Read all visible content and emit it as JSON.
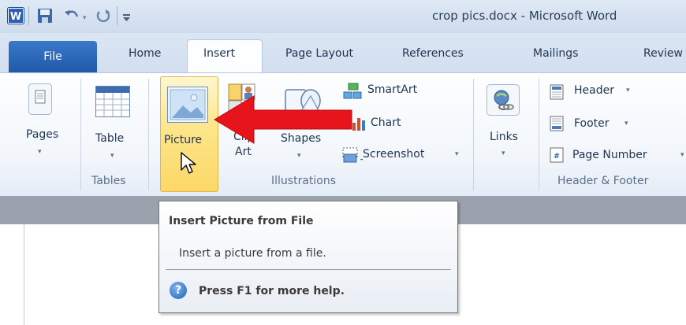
{
  "window": {
    "title": "crop pics.docx - Microsoft Word"
  },
  "tabs": [
    {
      "label": "File"
    },
    {
      "label": "Home"
    },
    {
      "label": "Insert"
    },
    {
      "label": "Page Layout"
    },
    {
      "label": "References"
    },
    {
      "label": "Mailings"
    },
    {
      "label": "Review"
    }
  ],
  "ribbon": {
    "pages": {
      "label": "Pages"
    },
    "table": {
      "label": "Table"
    },
    "tables_group": "Tables",
    "picture": {
      "label": "Picture"
    },
    "clipart": {
      "label_line1": "Clip",
      "label_line2": "Art"
    },
    "shapes": {
      "label": "Shapes"
    },
    "smartart": {
      "label": "SmartArt"
    },
    "chart": {
      "label": "Chart"
    },
    "screenshot": {
      "label": "Screenshot"
    },
    "illustrations_group": "Illustrations",
    "links": {
      "label": "Links"
    },
    "header": {
      "label": "Header"
    },
    "footer": {
      "label": "Footer"
    },
    "page_number": {
      "label": "Page Number"
    },
    "header_footer_group": "Header & Footer"
  },
  "tooltip": {
    "title": "Insert Picture from File",
    "body": "Insert a picture from a file.",
    "help": "Press F1 for more help.",
    "help_glyph": "?"
  },
  "dropdown_glyph": "▾",
  "colors": {
    "accent_file_tab": "#2a66b8",
    "highlight": "#fde58a",
    "annotation_arrow": "#e8141b"
  },
  "icons": [
    "word-logo-icon",
    "save-icon",
    "undo-icon",
    "redo-icon",
    "customize-qat-icon",
    "pages-icon",
    "table-icon",
    "picture-icon",
    "clipart-icon",
    "shapes-icon",
    "smartart-icon",
    "chart-icon",
    "screenshot-icon",
    "links-icon",
    "header-icon",
    "footer-icon",
    "page-number-icon",
    "help-icon",
    "mouse-cursor-icon",
    "red-arrow-icon"
  ]
}
